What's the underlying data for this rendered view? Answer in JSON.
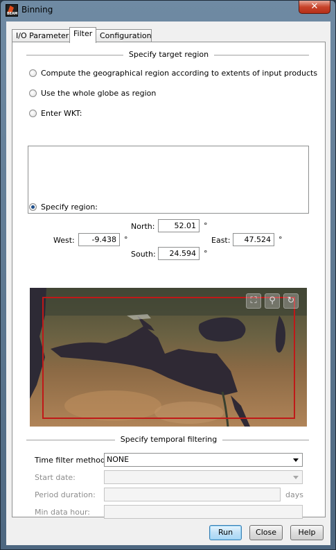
{
  "window": {
    "title": "Binning",
    "app_icon_text": "BEAM"
  },
  "tabs": [
    {
      "label": "I/O Parameters"
    },
    {
      "label": "Filter"
    },
    {
      "label": "Configuration"
    }
  ],
  "target_region": {
    "section_title": "Specify target region",
    "option_extents": "Compute the geographical region according to extents of input products",
    "option_globe": "Use the whole globe as region",
    "option_wkt": "Enter WKT:",
    "wkt_value": "",
    "option_region": "Specify region:",
    "selected_option": "region",
    "north_label": "North:",
    "north_value": "52.01",
    "west_label": "West:",
    "west_value": "-9.438",
    "east_label": "East:",
    "east_value": "47.524",
    "south_label": "South:",
    "south_value": "24.594",
    "degree_symbol": "°"
  },
  "map": {
    "zoom_all_icon": "zoom-all-icon",
    "zoom_tool_icon": "magnifier-icon",
    "pan_icon": "pan-icon",
    "region_color": "#c01818"
  },
  "temporal": {
    "section_title": "Specify temporal filtering",
    "method_label": "Time filter method:",
    "method_value": "NONE",
    "start_label": "Start date:",
    "start_value": "",
    "period_label": "Period duration:",
    "period_value": "",
    "period_unit": "days",
    "min_hour_label": "Min data hour:",
    "min_hour_value": ""
  },
  "buttons": {
    "run": "Run",
    "close": "Close",
    "help": "Help"
  },
  "close_glyph": "✕"
}
